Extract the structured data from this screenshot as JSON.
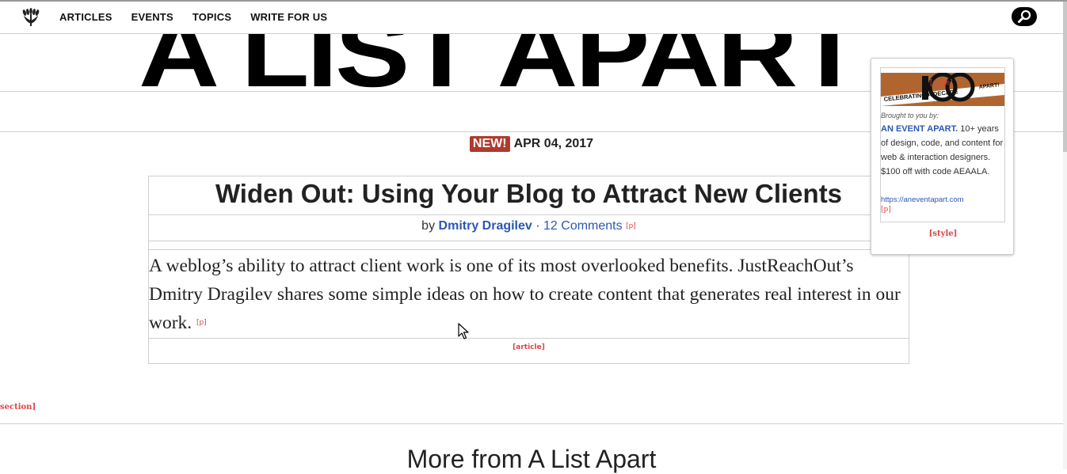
{
  "nav": {
    "logo_icon": "laurel-icon",
    "links": [
      "ARTICLES",
      "EVENTS",
      "TOPICS",
      "WRITE FOR US"
    ],
    "search_icon": "search-icon"
  },
  "masthead": {
    "title": "A LIST APART"
  },
  "article": {
    "badge": "NEW!",
    "date": "APR 04, 2017",
    "title": "Widen Out: Using Your Blog to Attract New Clients",
    "by": "by",
    "author": "Dmitry Dragilev",
    "separator": "·",
    "comments": "12 Comments",
    "p_tag": "[p]",
    "excerpt": "A weblog’s ability to attract client work is one of its most overlooked benefits. JustReachOut’s Dmitry Dragilev shares some simple ideas on how to create content that generates real interest in our work.",
    "excerpt_tag": "[p]",
    "article_tag": "[article]"
  },
  "section_tag": "section]",
  "more_heading": "More from A List Apart",
  "ad": {
    "style_tag_top": "[style]",
    "banner_text_left": "CELEBRATING A DECADE",
    "banner_text_right": "APART!",
    "brought_by": "Brought to you by:",
    "brand": "AN EVENT APART.",
    "copy": " 10+ years of design, code, and content for web & interaction designers. $100 off with code AEAALA.",
    "url": "https://aneventapart.com",
    "p_tag": "[p]",
    "style_tag_bottom": "[style]"
  },
  "colors": {
    "accent_red": "#b03a2e",
    "link_blue": "#2b58b4",
    "debug_tag": "#dd4444"
  }
}
